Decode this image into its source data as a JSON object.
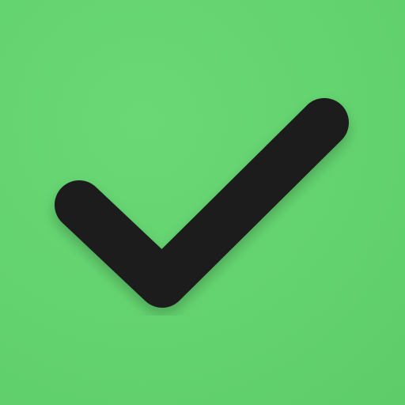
{
  "app_icon": {
    "icon": "checkmark-icon",
    "background_color": "#63d36f",
    "checkmark_color": "#1a1a1a"
  }
}
